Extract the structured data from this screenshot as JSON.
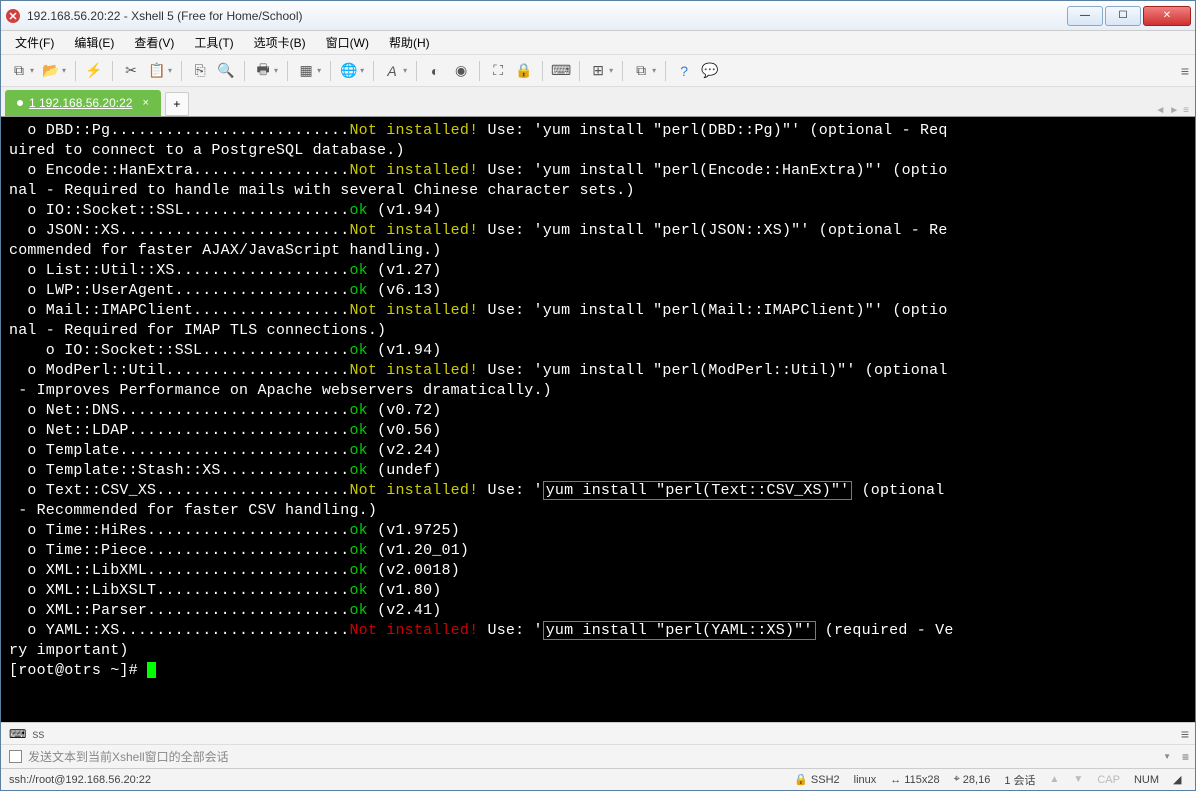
{
  "window": {
    "title": "192.168.56.20:22 - Xshell 5 (Free for Home/School)"
  },
  "menu": {
    "file": "文件(F)",
    "edit": "编辑(E)",
    "view": "查看(V)",
    "tools": "工具(T)",
    "tabs": "选项卡(B)",
    "window": "窗口(W)",
    "help": "帮助(H)"
  },
  "tab": {
    "label": "1 192.168.56.20:22"
  },
  "terminal": {
    "lines": [
      {
        "segs": [
          {
            "t": "  o DBD::Pg.........................."
          },
          {
            "t": "Not installed!",
            "c": "t-yellow"
          },
          {
            "t": " Use: 'yum install \"perl(DBD::Pg)\"' (optional - Req"
          }
        ]
      },
      {
        "segs": [
          {
            "t": "uired to connect to a PostgreSQL database.)"
          }
        ]
      },
      {
        "segs": [
          {
            "t": "  o Encode::HanExtra................."
          },
          {
            "t": "Not installed!",
            "c": "t-yellow"
          },
          {
            "t": " Use: 'yum install \"perl(Encode::HanExtra)\"' (optio"
          }
        ]
      },
      {
        "segs": [
          {
            "t": "nal - Required to handle mails with several Chinese character sets.)"
          }
        ]
      },
      {
        "segs": [
          {
            "t": "  o IO::Socket::SSL.................."
          },
          {
            "t": "ok",
            "c": "t-green"
          },
          {
            "t": " (v1.94)"
          }
        ]
      },
      {
        "segs": [
          {
            "t": "  o JSON::XS........................."
          },
          {
            "t": "Not installed!",
            "c": "t-yellow"
          },
          {
            "t": " Use: 'yum install \"perl(JSON::XS)\"' (optional - Re"
          }
        ]
      },
      {
        "segs": [
          {
            "t": "commended for faster AJAX/JavaScript handling.)"
          }
        ]
      },
      {
        "segs": [
          {
            "t": "  o List::Util::XS..................."
          },
          {
            "t": "ok",
            "c": "t-green"
          },
          {
            "t": " (v1.27)"
          }
        ]
      },
      {
        "segs": [
          {
            "t": "  o LWP::UserAgent..................."
          },
          {
            "t": "ok",
            "c": "t-green"
          },
          {
            "t": " (v6.13)"
          }
        ]
      },
      {
        "segs": [
          {
            "t": "  o Mail::IMAPClient................."
          },
          {
            "t": "Not installed!",
            "c": "t-yellow"
          },
          {
            "t": " Use: 'yum install \"perl(Mail::IMAPClient)\"' (optio"
          }
        ]
      },
      {
        "segs": [
          {
            "t": "nal - Required for IMAP TLS connections.)"
          }
        ]
      },
      {
        "segs": [
          {
            "t": "    o IO::Socket::SSL................"
          },
          {
            "t": "ok",
            "c": "t-green"
          },
          {
            "t": " (v1.94)"
          }
        ]
      },
      {
        "segs": [
          {
            "t": "  o ModPerl::Util...................."
          },
          {
            "t": "Not installed!",
            "c": "t-yellow"
          },
          {
            "t": " Use: 'yum install \"perl(ModPerl::Util)\"' (optional"
          }
        ]
      },
      {
        "segs": [
          {
            "t": " - Improves Performance on Apache webservers dramatically.)"
          }
        ]
      },
      {
        "segs": [
          {
            "t": "  o Net::DNS........................."
          },
          {
            "t": "ok",
            "c": "t-green"
          },
          {
            "t": " (v0.72)"
          }
        ]
      },
      {
        "segs": [
          {
            "t": "  o Net::LDAP........................"
          },
          {
            "t": "ok",
            "c": "t-green"
          },
          {
            "t": " (v0.56)"
          }
        ]
      },
      {
        "segs": [
          {
            "t": "  o Template........................."
          },
          {
            "t": "ok",
            "c": "t-green"
          },
          {
            "t": " (v2.24)"
          }
        ]
      },
      {
        "segs": [
          {
            "t": "  o Template::Stash::XS.............."
          },
          {
            "t": "ok",
            "c": "t-green"
          },
          {
            "t": " (undef)"
          }
        ]
      },
      {
        "segs": [
          {
            "t": "  o Text::CSV_XS....................."
          },
          {
            "t": "Not installed!",
            "c": "t-yellow"
          },
          {
            "t": " Use: '"
          },
          {
            "t": "yum install \"perl(Text::CSV_XS)\"'",
            "hl": true
          },
          {
            "t": " (optional"
          }
        ]
      },
      {
        "segs": [
          {
            "t": " - Recommended for faster CSV handling.)"
          }
        ]
      },
      {
        "segs": [
          {
            "t": "  o Time::HiRes......................"
          },
          {
            "t": "ok",
            "c": "t-green"
          },
          {
            "t": " (v1.9725)"
          }
        ]
      },
      {
        "segs": [
          {
            "t": "  o Time::Piece......................"
          },
          {
            "t": "ok",
            "c": "t-green"
          },
          {
            "t": " (v1.20_01)"
          }
        ]
      },
      {
        "segs": [
          {
            "t": "  o XML::LibXML......................"
          },
          {
            "t": "ok",
            "c": "t-green"
          },
          {
            "t": " (v2.0018)"
          }
        ]
      },
      {
        "segs": [
          {
            "t": "  o XML::LibXSLT....................."
          },
          {
            "t": "ok",
            "c": "t-green"
          },
          {
            "t": " (v1.80)"
          }
        ]
      },
      {
        "segs": [
          {
            "t": "  o XML::Parser......................"
          },
          {
            "t": "ok",
            "c": "t-green"
          },
          {
            "t": " (v2.41)"
          }
        ]
      },
      {
        "segs": [
          {
            "t": "  o YAML::XS........................."
          },
          {
            "t": "Not installed!",
            "c": "t-red"
          },
          {
            "t": " Use: '"
          },
          {
            "t": "yum install \"perl(YAML::XS)\"'",
            "hl": true
          },
          {
            "t": " (required - Ve"
          }
        ]
      },
      {
        "segs": [
          {
            "t": "ry important)"
          }
        ]
      },
      {
        "segs": [
          {
            "t": "[root@otrs ~]# "
          },
          {
            "cursor": true
          }
        ]
      }
    ]
  },
  "bottom": {
    "input_label": "ss",
    "checkbox_label": "发送文本到当前Xshell窗口的全部会话"
  },
  "status": {
    "url": "ssh://root@192.168.56.20:22",
    "proto": "SSH2",
    "os": "linux",
    "size": "115x28",
    "pos": "28,16",
    "sessions": "1 会话",
    "cap": "CAP",
    "num": "NUM"
  }
}
